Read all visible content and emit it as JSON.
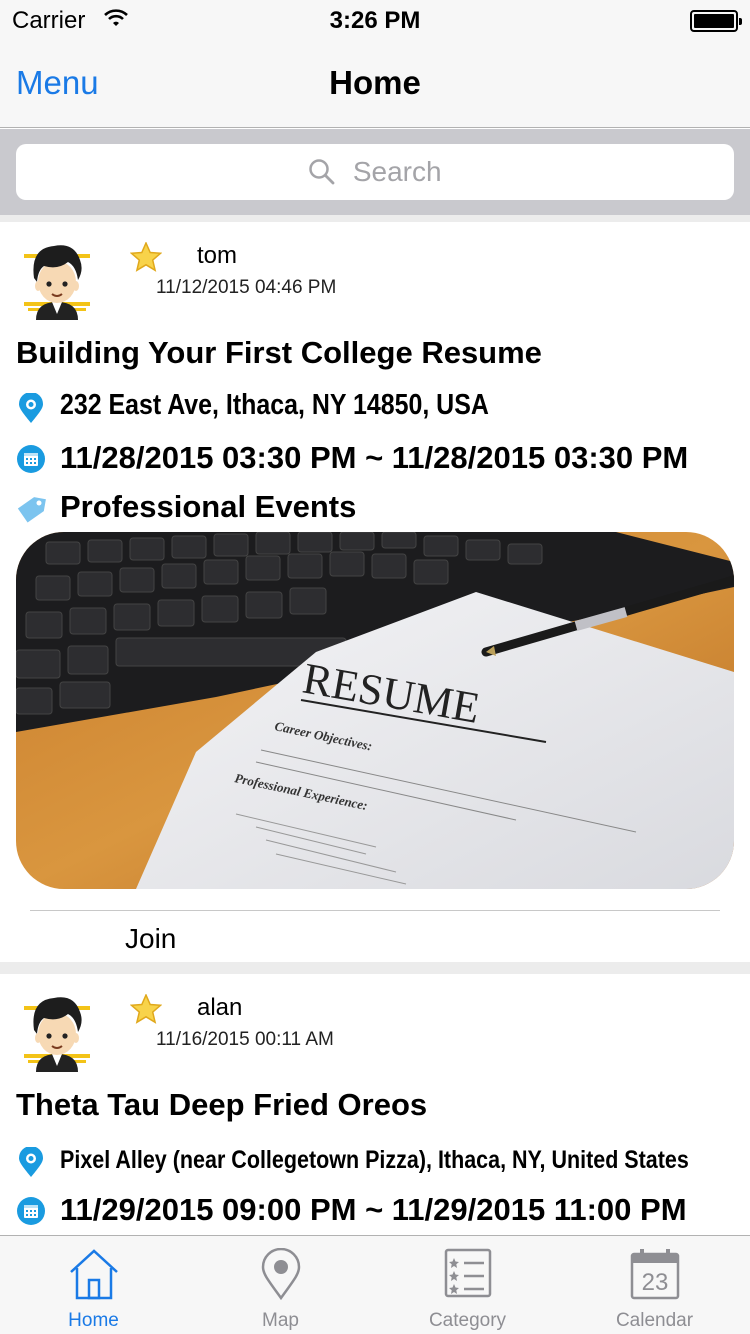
{
  "status_bar": {
    "carrier": "Carrier",
    "time": "3:26 PM"
  },
  "nav": {
    "menu_label": "Menu",
    "title": "Home"
  },
  "search": {
    "placeholder": "Search"
  },
  "posts": [
    {
      "username": "tom",
      "posted": "11/12/2015 04:46 PM",
      "title": "Building Your First College Resume",
      "location": "232 East Ave, Ithaca, NY 14850, USA",
      "time_range": "11/28/2015 03:30 PM ~ 11/28/2015 03:30 PM",
      "category": "Professional Events",
      "image_text": {
        "heading": "RESUME",
        "section1": "Career Objectives:",
        "section2": "Professional Experience:"
      },
      "action": "Join"
    },
    {
      "username": "alan",
      "posted": "11/16/2015 00:11 AM",
      "title": "Theta Tau Deep Fried Oreos",
      "location": "Pixel Alley (near Collegetown Pizza), Ithaca, NY, United States",
      "time_range": "11/29/2015 09:00 PM ~ 11/29/2015 11:00 PM"
    }
  ],
  "tabs": [
    {
      "label": "Home",
      "icon": "home-icon",
      "active": true
    },
    {
      "label": "Map",
      "icon": "map-pin-icon",
      "active": false
    },
    {
      "label": "Category",
      "icon": "category-list-icon",
      "active": false
    },
    {
      "label": "Calendar",
      "icon": "calendar-icon",
      "active": false,
      "calendar_day": "23"
    }
  ],
  "colors": {
    "accent": "#1a7ae6",
    "icon_blue": "#1a9be0",
    "star": "#f5c518"
  }
}
